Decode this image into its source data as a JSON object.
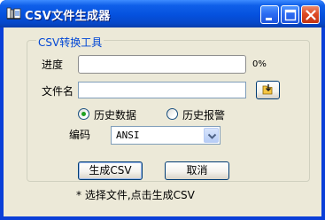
{
  "window": {
    "title": "CSV文件生成器",
    "controls": {
      "minimize": "minimize-icon",
      "maximize": "maximize-icon",
      "close": "close-icon"
    }
  },
  "group": {
    "title": "CSV转换工具"
  },
  "progress": {
    "label": "进度",
    "value_text": "0%",
    "value": 0
  },
  "file": {
    "label": "文件名",
    "value": "",
    "browse_icon": "folder-open-icon"
  },
  "data_type": {
    "options": [
      {
        "label": "历史数据",
        "selected": true
      },
      {
        "label": "历史报警",
        "selected": false
      }
    ]
  },
  "encoding": {
    "label": "编码",
    "value": "ANSI"
  },
  "actions": {
    "generate_label": "生成CSV",
    "cancel_label": "取消"
  },
  "hint": "* 选择文件,点击生成CSV",
  "colors": {
    "title_bar": "#0551de",
    "client_bg": "#ece9d8",
    "group_title": "#0046d5",
    "radio_dot": "#21a121"
  }
}
